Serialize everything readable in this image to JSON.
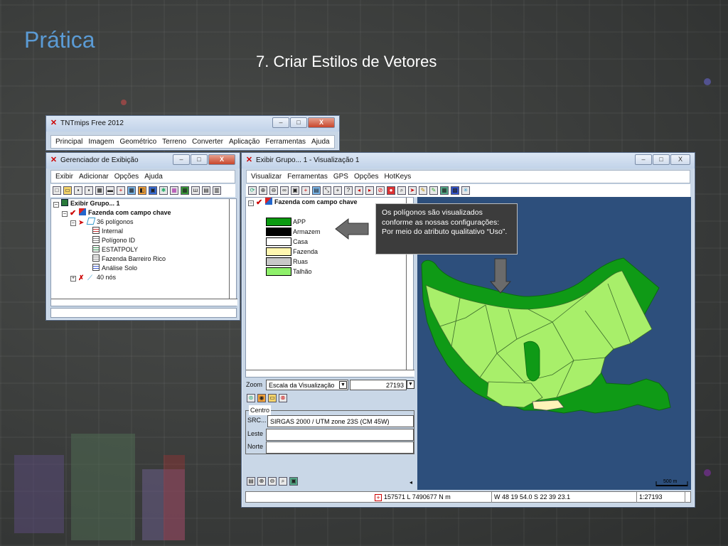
{
  "slide": {
    "title": "Prática",
    "subtitle": "7. Criar Estilos de Vetores"
  },
  "main_window": {
    "title": "TNTmips Free 2012",
    "menu": [
      "Principal",
      "Imagem",
      "Geométrico",
      "Terreno",
      "Converter",
      "Aplicação",
      "Ferramentas",
      "Ajuda"
    ],
    "controls": [
      "–",
      "□",
      "X"
    ]
  },
  "display_manager": {
    "title": "Gerenciador de Exibição",
    "menu": [
      "Exibir",
      "Adicionar",
      "Opções",
      "Ajuda"
    ],
    "controls": [
      "–",
      "□",
      "X"
    ],
    "tree": {
      "group": "Exibir Grupo... 1",
      "layer": "Fazenda com campo chave",
      "polygons": "36 polígonos",
      "tables": [
        "Internal",
        "Polígono ID",
        "ESTATPOLY",
        "Fazenda Barreiro Rico",
        "Análise Solo"
      ],
      "nodes": "40 nós"
    }
  },
  "view_window": {
    "title": "Exibir Grupo... 1 - Visualização 1",
    "menu": [
      "Visualizar",
      "Ferramentas",
      "GPS",
      "Opções",
      "HotKeys"
    ],
    "controls": [
      "–",
      "□",
      "X"
    ],
    "legend_layer": "Fazenda com campo chave",
    "legend": [
      {
        "label": "APP",
        "color": "#0a9a10"
      },
      {
        "label": "Armazem",
        "color": "#000000"
      },
      {
        "label": "Casa",
        "color": "#ffffff"
      },
      {
        "label": "Fazenda",
        "color": "#fff6b0"
      },
      {
        "label": "Ruas",
        "color": "#c8c8c8"
      },
      {
        "label": "Talhão",
        "color": "#8ff06b"
      }
    ],
    "zoom_label": "Zoom",
    "zoom_mode": "Escala da Visualização",
    "zoom_value": "27193",
    "center_label": "Centro",
    "src_label": "SRC...",
    "src_value": "SIRGAS 2000 / UTM zone 23S (CM 45W)",
    "leste_label": "Leste",
    "norte_label": "Norte",
    "scale_bar": "500 m",
    "status": {
      "coords": "157571 L 7490677 N m",
      "geo": "W 48 19 54.0  S 22 39 23.1",
      "scale": "1:27193"
    },
    "map_colors": {
      "water": "#2d4f7c",
      "app": "#0f9a16",
      "talhao": "#a8ef6a",
      "fazenda": "#fff3b8"
    }
  },
  "callout": {
    "text": "Os polígonos são visualizados conforme as nossas configurações: Por meio do atributo qualitativo “Uso”."
  }
}
